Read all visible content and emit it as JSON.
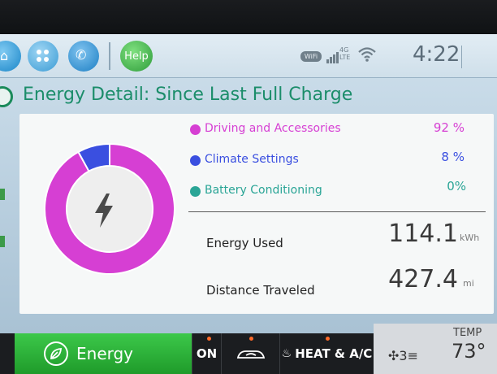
{
  "status_bar": {
    "help_label": "Help",
    "wifi_badge": "WiFi",
    "network_label": "4G\nLTE",
    "clock": "4:22"
  },
  "header": {
    "title": "Energy Detail: Since Last Full Charge"
  },
  "breakdown": {
    "items": [
      {
        "label": "Driving and Accessories",
        "percent": "92 %",
        "value": 92,
        "color": "#d63fd3"
      },
      {
        "label": "Climate Settings",
        "percent": "8 %",
        "value": 8,
        "color": "#3a4fe0"
      },
      {
        "label": "Battery Conditioning",
        "percent": "0%",
        "value": 0,
        "color": "#2aa596"
      }
    ]
  },
  "stats": {
    "energy_used": {
      "label": "Energy Used",
      "value": "114.1",
      "unit": "kWh"
    },
    "distance": {
      "label": "Distance Traveled",
      "value": "427.4",
      "unit": "mi"
    }
  },
  "pager": {
    "pages": 3,
    "current": 1
  },
  "bottom_bar": {
    "energy_label": "Energy",
    "on_label": "ON",
    "heat_ac_label": "HEAT & A/C",
    "fan_level": "3",
    "temp_label": "TEMP",
    "temp_value": "73°"
  }
}
